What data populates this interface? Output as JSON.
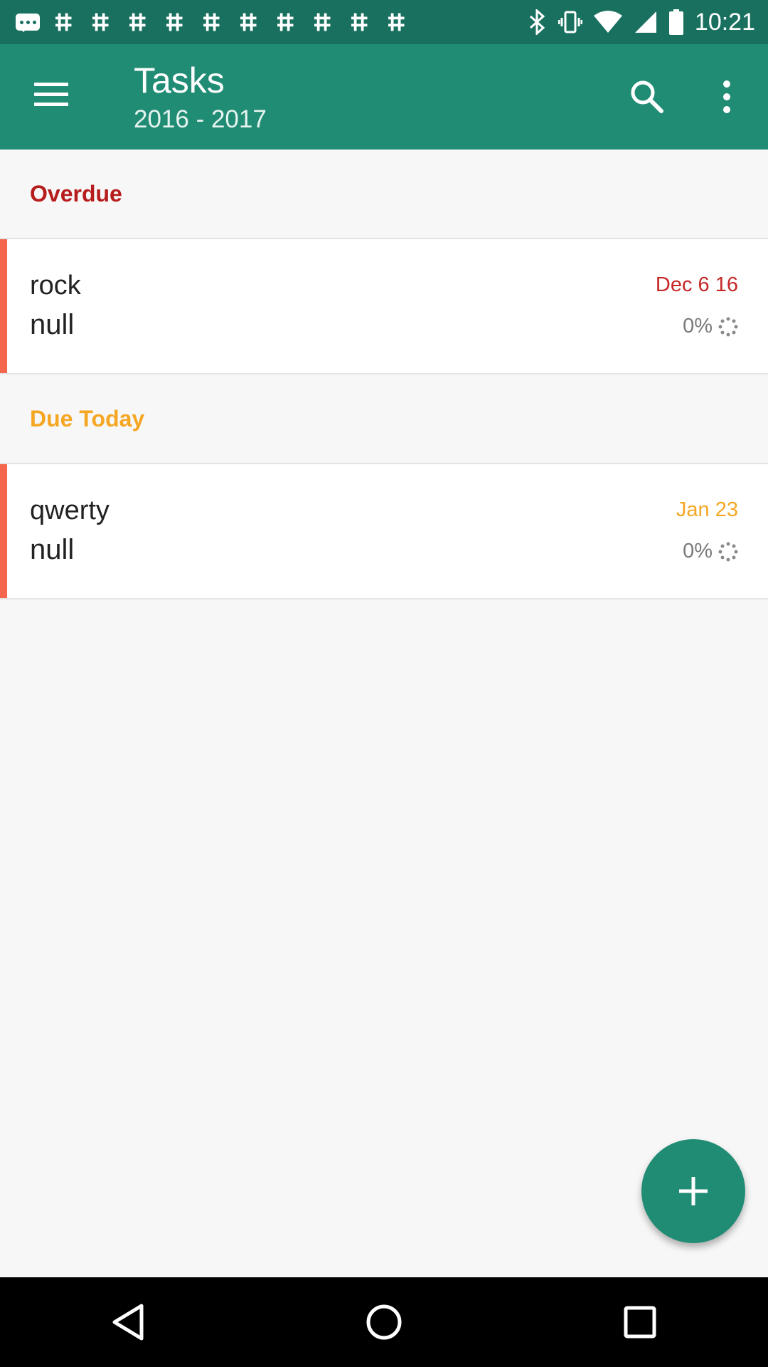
{
  "status_bar": {
    "time": "10:21",
    "notification_icons": [
      "chat-bubble-icon",
      "grid-icon",
      "grid-icon",
      "grid-icon",
      "grid-icon",
      "grid-icon",
      "grid-icon",
      "grid-icon",
      "grid-icon",
      "grid-icon",
      "grid-icon"
    ],
    "system_icons": [
      "bluetooth-icon",
      "vibrate-icon",
      "wifi-icon",
      "signal-icon",
      "battery-icon"
    ]
  },
  "app_bar": {
    "title": "Tasks",
    "subtitle": "2016 - 2017",
    "icons": {
      "menu": "hamburger-menu-icon",
      "search": "search-icon",
      "more": "more-vert-icon"
    }
  },
  "sections": [
    {
      "label": "Overdue",
      "color": "#b71c1c",
      "tasks": [
        {
          "name": "rock",
          "description": "null",
          "date": "Dec 6 16",
          "date_color": "#c62828",
          "progress": "0%"
        }
      ]
    },
    {
      "label": "Due Today",
      "color": "#f5a623",
      "tasks": [
        {
          "name": "qwerty",
          "description": "null",
          "date": "Jan 23",
          "date_color": "#f5a623",
          "progress": "0%"
        }
      ]
    }
  ],
  "fab": {
    "icon": "add-icon"
  },
  "nav_bar": {
    "icons": [
      "back-triangle-icon",
      "home-circle-icon",
      "recents-square-icon"
    ]
  },
  "colors": {
    "primary": "#218c74",
    "primary_dark": "#19705f",
    "accent_stripe": "#f4664d"
  }
}
